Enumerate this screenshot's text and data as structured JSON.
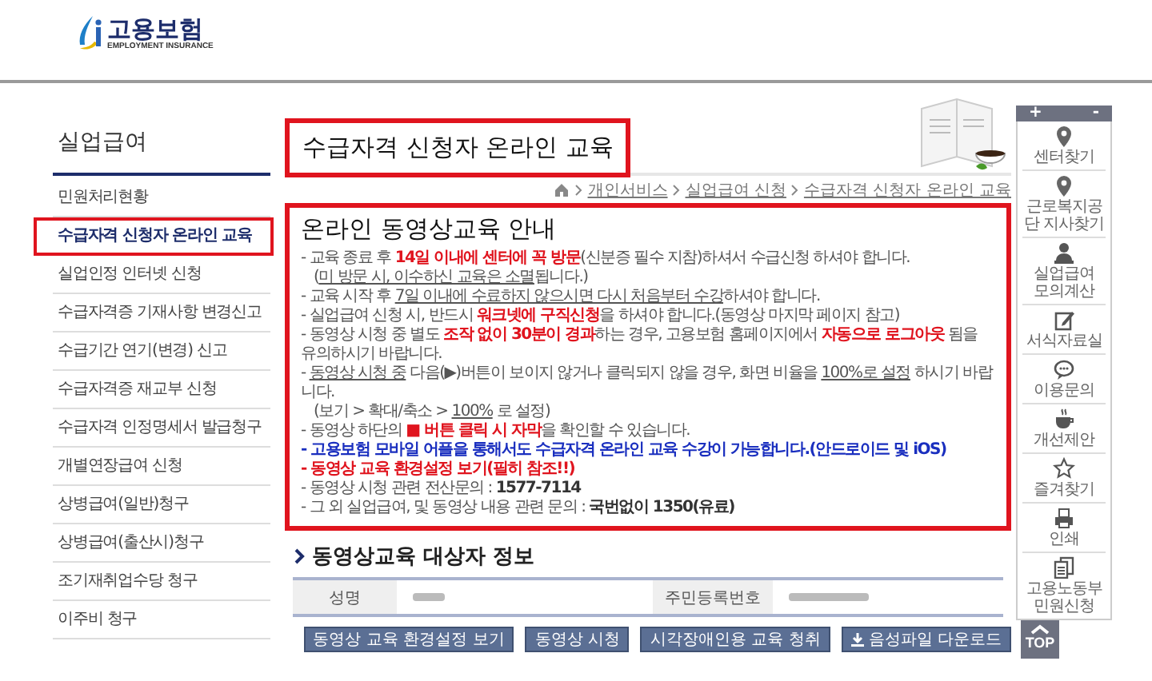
{
  "header": {
    "logo": {
      "name": "고용보험",
      "subtitle": "EMPLOYMENT INSURANCE"
    }
  },
  "sidebar": {
    "title": "실업급여",
    "items": [
      {
        "label": "민원처리현황",
        "selected": false
      },
      {
        "label": "수급자격 신청자 온라인 교육",
        "selected": true
      },
      {
        "label": "실업인정 인터넷 신청",
        "selected": false
      },
      {
        "label": "수급자격증 기재사항 변경신고",
        "selected": false
      },
      {
        "label": "수급기간 연기(변경) 신고",
        "selected": false
      },
      {
        "label": "수급자격증 재교부 신청",
        "selected": false
      },
      {
        "label": "수급자격 인정명세서 발급청구",
        "selected": false
      },
      {
        "label": "개별연장급여 신청",
        "selected": false
      },
      {
        "label": "상병급여(일반)청구",
        "selected": false
      },
      {
        "label": "상병급여(출산시)청구",
        "selected": false
      },
      {
        "label": "조기재취업수당 청구",
        "selected": false
      },
      {
        "label": "이주비 청구",
        "selected": false
      }
    ]
  },
  "page_title": "수급자격 신청자 온라인 교육",
  "breadcrumb": [
    "개인서비스",
    "실업급여 신청",
    "수급자격 신청자 온라인 교육"
  ],
  "notice": {
    "title": "온라인 동영상교육 안내",
    "lines": [
      {
        "kind": "bullet",
        "segments": [
          {
            "kind": "plain",
            "text": "- 교육 종료 후 "
          },
          {
            "kind": "warning",
            "text": "14일 이내에 센터에 꼭 방문"
          },
          {
            "kind": "plain",
            "text": "(신분증 필수 지참)하셔서 수급신청 하셔야 합니다."
          }
        ]
      },
      {
        "kind": "continuation",
        "segments": [
          {
            "kind": "plain",
            "text": "("
          },
          {
            "kind": "underlined",
            "text": "미 방문 시, 이수하신 교육은 소멸"
          },
          {
            "kind": "plain",
            "text": "됩니다.)"
          }
        ]
      },
      {
        "kind": "bullet",
        "segments": [
          {
            "kind": "plain",
            "text": "- 교육 시작 후 "
          },
          {
            "kind": "underlined",
            "text": "7일 이내에 수료하지 않으시면 다시 처음부터 수강"
          },
          {
            "kind": "plain",
            "text": "하셔야 합니다."
          }
        ]
      },
      {
        "kind": "bullet",
        "segments": [
          {
            "kind": "plain",
            "text": "- 실업급여 신청 시, 반드시 "
          },
          {
            "kind": "warning",
            "text": "워크넷에 구직신청"
          },
          {
            "kind": "plain",
            "text": "을 하셔야 합니다.(동영상 마지막 페이지 참고)"
          }
        ]
      },
      {
        "kind": "bullet",
        "segments": [
          {
            "kind": "plain",
            "text": "- 동영상 시청 중 별도 "
          },
          {
            "kind": "warning",
            "text": "조작 없이 30분이 경과"
          },
          {
            "kind": "plain",
            "text": "하는 경우, 고용보험 홈페이지에서 "
          },
          {
            "kind": "warning",
            "text": "자동으로 로그아웃"
          },
          {
            "kind": "plain",
            "text": " 됨을 유의하시기 바랍니다."
          }
        ]
      },
      {
        "kind": "bullet",
        "segments": [
          {
            "kind": "plain",
            "text": "- "
          },
          {
            "kind": "underlined",
            "text": "동영상 시청 중"
          },
          {
            "kind": "plain",
            "text": " 다음(▶)버튼이 보이지 않거나 클릭되지 않을 경우, 화면 비율을 "
          },
          {
            "kind": "underlined",
            "text": "100%로 설정"
          },
          {
            "kind": "plain",
            "text": " 하시기 바랍니다."
          }
        ]
      },
      {
        "kind": "continuation",
        "segments": [
          {
            "kind": "plain",
            "text": "(보기 > 확대/축소 > "
          },
          {
            "kind": "underlined",
            "text": "100%"
          },
          {
            "kind": "plain",
            "text": " 로 설정)"
          }
        ]
      },
      {
        "kind": "bullet",
        "segments": [
          {
            "kind": "plain",
            "text": "- 동영상 하단의 "
          },
          {
            "kind": "warning",
            "text": "■ 버튼 클릭 시 자막"
          },
          {
            "kind": "plain",
            "text": "을 확인할 수 있습니다."
          }
        ]
      },
      {
        "kind": "bullet",
        "segments": [
          {
            "kind": "info",
            "text": "- 고용보험 모바일 어플을 통해서도 수급자격 온라인 교육 수강이 가능합니다.(안드로이드 및 iOS)"
          }
        ]
      },
      {
        "kind": "bullet",
        "segments": [
          {
            "kind": "warning",
            "text": "- 동영상 교육 환경설정 보기(필히 참조!!)"
          }
        ]
      },
      {
        "kind": "bullet",
        "segments": [
          {
            "kind": "plain",
            "text": "- 동영상 시청 관련 전산문의 : "
          },
          {
            "kind": "strong",
            "text": "1577-7114"
          }
        ]
      },
      {
        "kind": "bullet",
        "segments": [
          {
            "kind": "plain",
            "text": "- 그 외 실업급여, 및 동영상 내용 관련 문의 : "
          },
          {
            "kind": "strong",
            "text": "국번없이 1350(유료)"
          }
        ]
      }
    ]
  },
  "applicant_info": {
    "title": "동영상교육 대상자 정보",
    "fields": [
      {
        "label": "성명"
      },
      {
        "label": "주민등록번호"
      }
    ]
  },
  "buttons": [
    {
      "kind": "plain",
      "label": "동영상 교육 환경설정 보기"
    },
    {
      "kind": "plain",
      "label": "동영상 시청"
    },
    {
      "kind": "plain",
      "label": "시각장애인용 교육 청취"
    },
    {
      "kind": "download",
      "label": "음성파일 다운로드"
    }
  ],
  "quick_menu": {
    "zoom_in": "+",
    "zoom_out": "-",
    "items": [
      {
        "kind": "pin",
        "label": "센터찾기"
      },
      {
        "kind": "pin",
        "label": "근로복지공단 지사찾기"
      },
      {
        "kind": "person",
        "label": "실업급여 모의계산"
      },
      {
        "kind": "edit",
        "label": "서식자료실"
      },
      {
        "kind": "chat",
        "label": "이용문의"
      },
      {
        "kind": "cup",
        "label": "개선제안"
      },
      {
        "kind": "star",
        "label": "즐겨찾기"
      },
      {
        "kind": "printer",
        "label": "인쇄"
      },
      {
        "kind": "documents",
        "label": "고용노동부 민원신청"
      }
    ],
    "top": "TOP"
  }
}
